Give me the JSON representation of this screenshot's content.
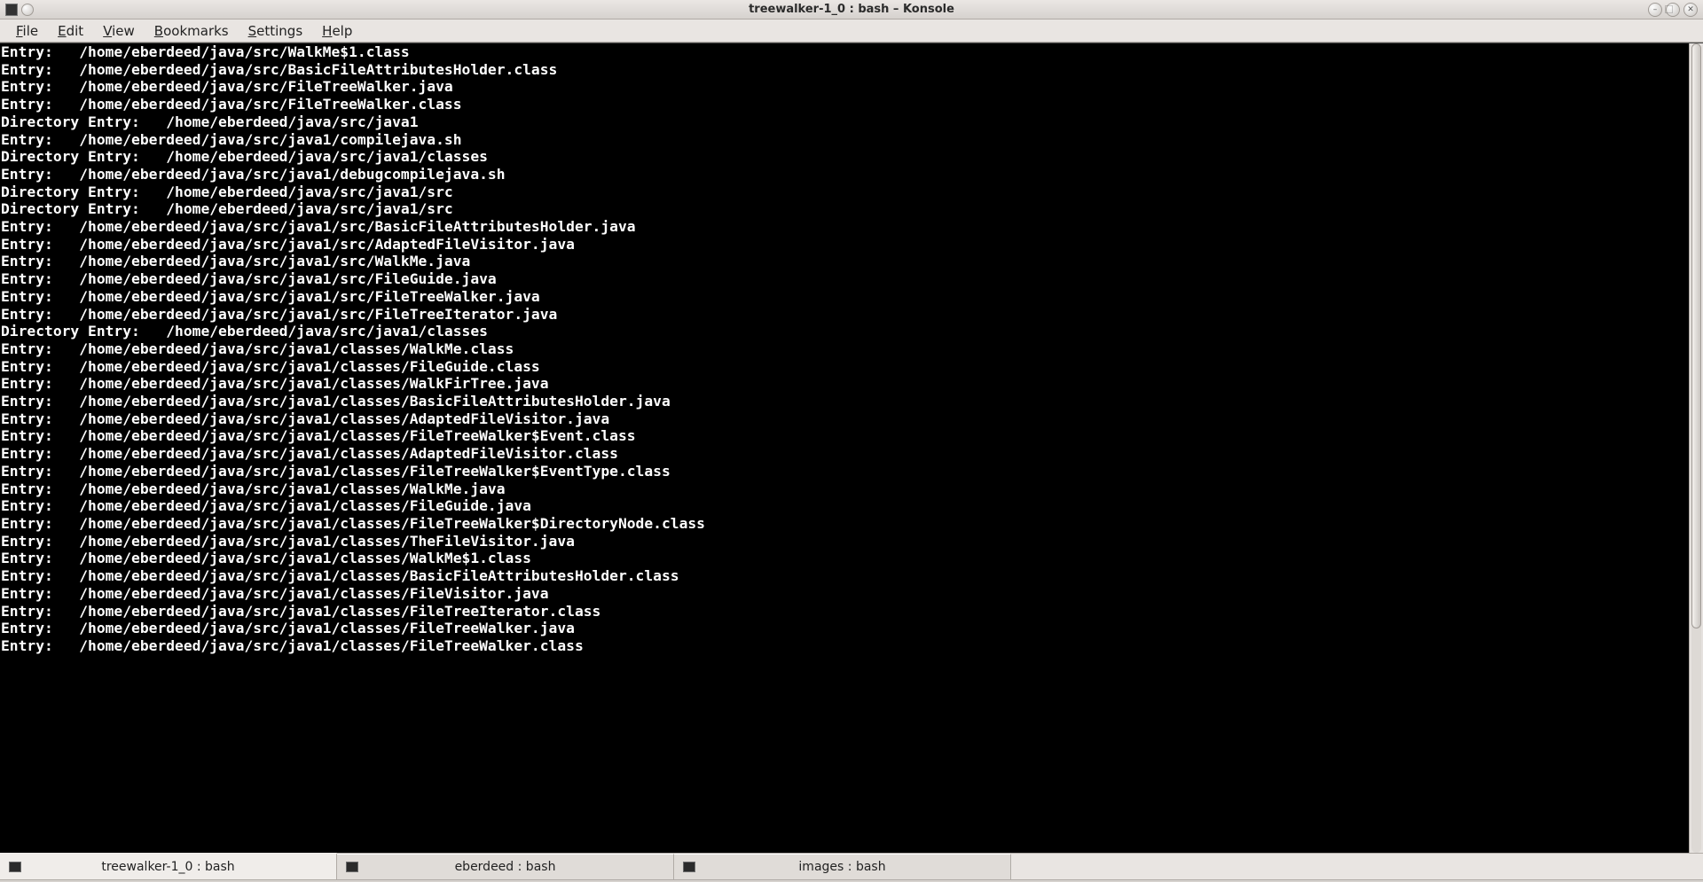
{
  "window": {
    "title": "treewalker-1_0 : bash – Konsole"
  },
  "menubar": {
    "items": [
      {
        "label": "File",
        "accel_index": 0
      },
      {
        "label": "Edit",
        "accel_index": 0
      },
      {
        "label": "View",
        "accel_index": 0
      },
      {
        "label": "Bookmarks",
        "accel_index": 0
      },
      {
        "label": "Settings",
        "accel_index": 0
      },
      {
        "label": "Help",
        "accel_index": 0
      }
    ]
  },
  "terminal": {
    "lines": [
      "Entry:   /home/eberdeed/java/src/WalkMe$1.class",
      "Entry:   /home/eberdeed/java/src/BasicFileAttributesHolder.class",
      "Entry:   /home/eberdeed/java/src/FileTreeWalker.java",
      "Entry:   /home/eberdeed/java/src/FileTreeWalker.class",
      "Directory Entry:   /home/eberdeed/java/src/java1",
      "Entry:   /home/eberdeed/java/src/java1/compilejava.sh",
      "Directory Entry:   /home/eberdeed/java/src/java1/classes",
      "Entry:   /home/eberdeed/java/src/java1/debugcompilejava.sh",
      "Directory Entry:   /home/eberdeed/java/src/java1/src",
      "Directory Entry:   /home/eberdeed/java/src/java1/src",
      "Entry:   /home/eberdeed/java/src/java1/src/BasicFileAttributesHolder.java",
      "Entry:   /home/eberdeed/java/src/java1/src/AdaptedFileVisitor.java",
      "Entry:   /home/eberdeed/java/src/java1/src/WalkMe.java",
      "Entry:   /home/eberdeed/java/src/java1/src/FileGuide.java",
      "Entry:   /home/eberdeed/java/src/java1/src/FileTreeWalker.java",
      "Entry:   /home/eberdeed/java/src/java1/src/FileTreeIterator.java",
      "Directory Entry:   /home/eberdeed/java/src/java1/classes",
      "Entry:   /home/eberdeed/java/src/java1/classes/WalkMe.class",
      "Entry:   /home/eberdeed/java/src/java1/classes/FileGuide.class",
      "Entry:   /home/eberdeed/java/src/java1/classes/WalkFirTree.java",
      "Entry:   /home/eberdeed/java/src/java1/classes/BasicFileAttributesHolder.java",
      "Entry:   /home/eberdeed/java/src/java1/classes/AdaptedFileVisitor.java",
      "Entry:   /home/eberdeed/java/src/java1/classes/FileTreeWalker$Event.class",
      "Entry:   /home/eberdeed/java/src/java1/classes/AdaptedFileVisitor.class",
      "Entry:   /home/eberdeed/java/src/java1/classes/FileTreeWalker$EventType.class",
      "Entry:   /home/eberdeed/java/src/java1/classes/WalkMe.java",
      "Entry:   /home/eberdeed/java/src/java1/classes/FileGuide.java",
      "Entry:   /home/eberdeed/java/src/java1/classes/FileTreeWalker$DirectoryNode.class",
      "Entry:   /home/eberdeed/java/src/java1/classes/TheFileVisitor.java",
      "Entry:   /home/eberdeed/java/src/java1/classes/WalkMe$1.class",
      "Entry:   /home/eberdeed/java/src/java1/classes/BasicFileAttributesHolder.class",
      "Entry:   /home/eberdeed/java/src/java1/classes/FileVisitor.java",
      "Entry:   /home/eberdeed/java/src/java1/classes/FileTreeIterator.class",
      "Entry:   /home/eberdeed/java/src/java1/classes/FileTreeWalker.java",
      "Entry:   /home/eberdeed/java/src/java1/classes/FileTreeWalker.class"
    ]
  },
  "tabs": [
    {
      "label": "treewalker-1_0 : bash",
      "active": true
    },
    {
      "label": "eberdeed : bash",
      "active": false
    },
    {
      "label": "images : bash",
      "active": false
    }
  ],
  "win_controls": {
    "minimize_glyph": "–",
    "maximize_glyph": "⃞",
    "close_glyph": "✕"
  }
}
